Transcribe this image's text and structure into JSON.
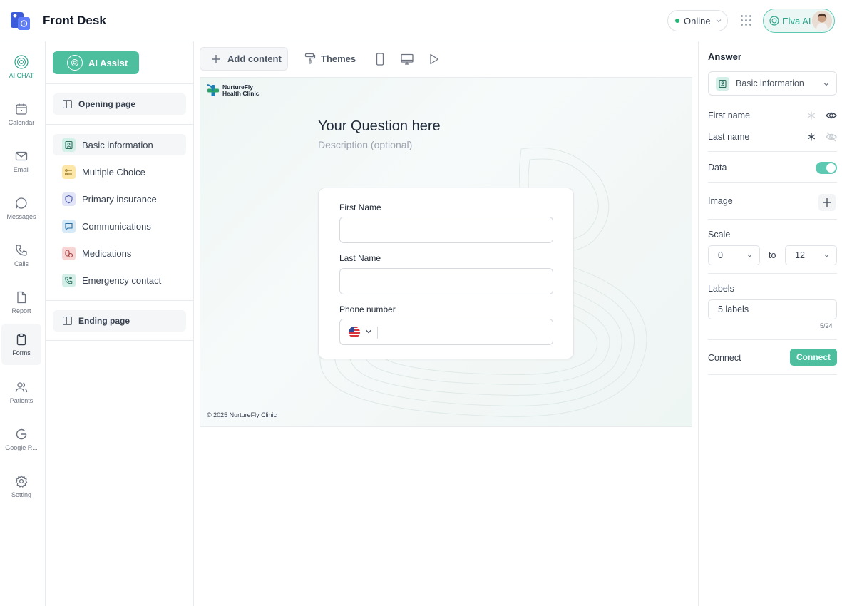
{
  "app": {
    "title": "Front Desk"
  },
  "header": {
    "status": "Online",
    "user_name": "Elva AI"
  },
  "nav": {
    "items": [
      {
        "label": "AI CHAT",
        "icon": "ai-orb-icon"
      },
      {
        "label": "Calendar",
        "icon": "calendar-icon"
      },
      {
        "label": "Email",
        "icon": "mail-icon"
      },
      {
        "label": "Messages",
        "icon": "chat-bubble-icon"
      },
      {
        "label": "Calls",
        "icon": "phone-icon"
      },
      {
        "label": "Report",
        "icon": "document-icon"
      },
      {
        "label": "Forms",
        "icon": "clipboard-icon"
      },
      {
        "label": "Patients",
        "icon": "users-icon"
      },
      {
        "label": "Google R...",
        "icon": "google-icon"
      },
      {
        "label": "Setting",
        "icon": "gear-icon"
      }
    ]
  },
  "outline": {
    "ai_assist_label": "AI Assist",
    "opening_page": "Opening page",
    "ending_page": "Ending page",
    "questions": [
      {
        "label": "Basic information",
        "icon": "contact-card-icon",
        "color": "#d3efe8"
      },
      {
        "label": "Multiple Choice",
        "icon": "list-icon",
        "color": "#fde7a8"
      },
      {
        "label": "Primary insurance",
        "icon": "shield-icon",
        "color": "#e2e5f8"
      },
      {
        "label": "Communications",
        "icon": "message-icon",
        "color": "#d5e9f7"
      },
      {
        "label": "Medications",
        "icon": "pills-icon",
        "color": "#f8d5d5"
      },
      {
        "label": "Emergency contact",
        "icon": "phone-heart-icon",
        "color": "#d3efe8"
      }
    ]
  },
  "toolbar": {
    "add_content": "Add content",
    "themes": "Themes"
  },
  "canvas": {
    "clinic_name_line1": "NurtureFly",
    "clinic_name_line2": "Health Clinic",
    "question_title": "Your Question here",
    "question_description": "Description (optional)",
    "fields": [
      {
        "label": "First Name",
        "value": ""
      },
      {
        "label": "Last Name",
        "value": ""
      },
      {
        "label": "Phone number",
        "value": ""
      }
    ],
    "copyright": "© 2025 NurtureFly Clinic"
  },
  "answer_panel": {
    "title": "Answer",
    "type_selected": "Basic information",
    "first_name": "First name",
    "last_name": "Last name",
    "data_label": "Data",
    "data_enabled": true,
    "image_label": "Image",
    "scale_label": "Scale",
    "scale_min": "0",
    "scale_to": "to",
    "scale_max": "12",
    "labels_label": "Labels",
    "labels_value": "5 labels",
    "labels_counter": "5/24",
    "connect_label": "Connect",
    "connect_button": "Connect"
  },
  "colors": {
    "accent": "#4dbf9f",
    "accent_light": "#eaf7f4",
    "status_online": "#22b573"
  }
}
